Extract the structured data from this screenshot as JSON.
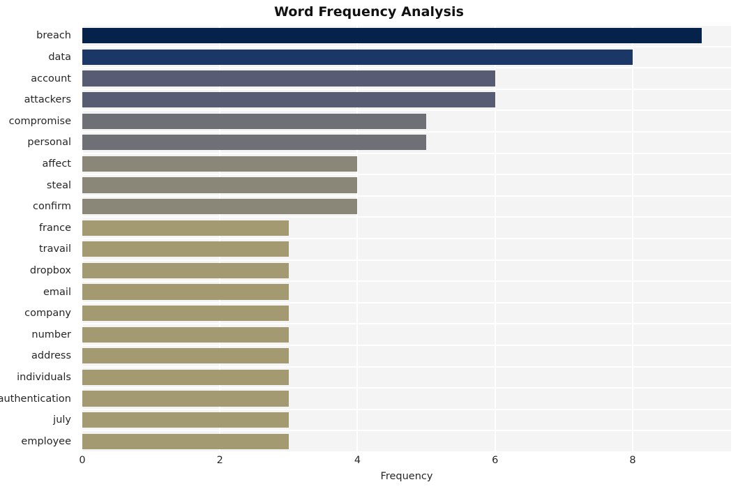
{
  "chart_data": {
    "type": "bar",
    "orientation": "horizontal",
    "title": "Word Frequency Analysis",
    "xlabel": "Frequency",
    "ylabel": "",
    "xlim": [
      0,
      9.43
    ],
    "ylim": [
      0,
      20
    ],
    "grid": true,
    "legend": null,
    "xticks": [
      "0",
      "2",
      "4",
      "6",
      "8"
    ],
    "xtick_values": [
      0,
      2,
      4,
      6,
      8
    ],
    "categories": [
      "breach",
      "data",
      "account",
      "attackers",
      "compromise",
      "personal",
      "affect",
      "steal",
      "confirm",
      "france",
      "travail",
      "dropbox",
      "email",
      "company",
      "number",
      "address",
      "individuals",
      "authentication",
      "july",
      "employee"
    ],
    "values": [
      9,
      8,
      6,
      6,
      5,
      5,
      4,
      4,
      4,
      3,
      3,
      3,
      3,
      3,
      3,
      3,
      3,
      3,
      3,
      3
    ],
    "bar_colors": [
      "#04224a",
      "#1a3768",
      "#585c72",
      "#585c72",
      "#6e7075",
      "#6e7075",
      "#8a8778",
      "#8a8778",
      "#8a8778",
      "#a39a71",
      "#a39a71",
      "#a39a71",
      "#a39a71",
      "#a39a71",
      "#a39a71",
      "#a39a71",
      "#a39a71",
      "#a39a71",
      "#a39a71",
      "#a39a71"
    ],
    "plot_background": "#f4f4f5",
    "gridline_color": "#ffffff",
    "figure_background": "#ffffff"
  }
}
